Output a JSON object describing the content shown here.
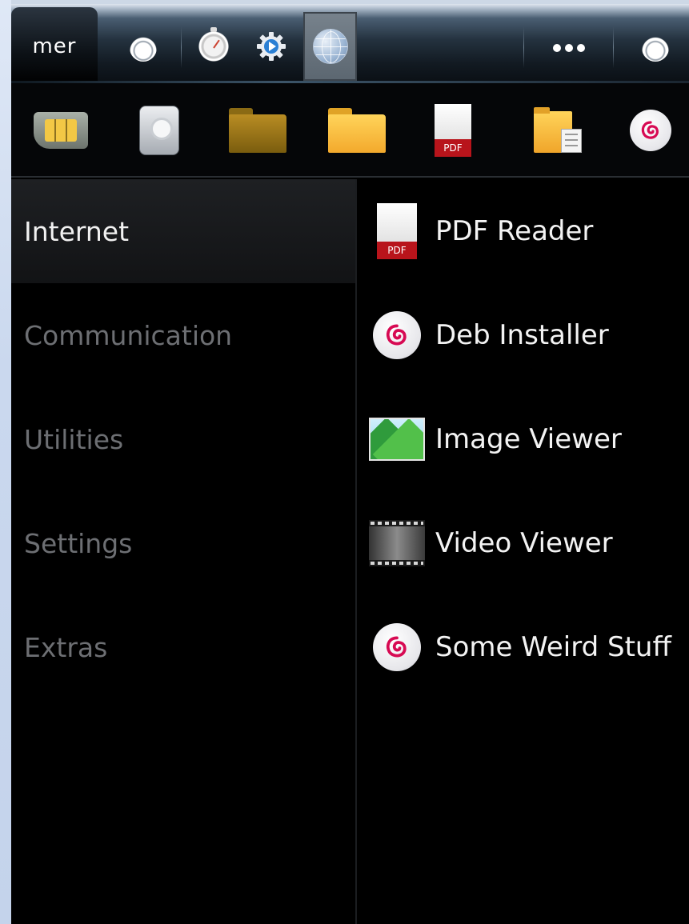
{
  "logo": {
    "text": "mer"
  },
  "shortcuts": {
    "pdf_label": "PDF"
  },
  "categories": [
    {
      "label": "Internet",
      "active": true
    },
    {
      "label": "Communication",
      "active": false
    },
    {
      "label": "Utilities",
      "active": false
    },
    {
      "label": "Settings",
      "active": false
    },
    {
      "label": "Extras",
      "active": false
    }
  ],
  "apps": [
    {
      "label": "PDF Reader",
      "icon": "pdf-icon",
      "icon_label": "PDF"
    },
    {
      "label": "Deb Installer",
      "icon": "debian-swirl-icon"
    },
    {
      "label": "Image Viewer",
      "icon": "image-viewer-icon"
    },
    {
      "label": "Video Viewer",
      "icon": "film-strip-icon"
    },
    {
      "label": "Some Weird Stuff",
      "icon": "debian-swirl-icon"
    }
  ],
  "colors": {
    "pdf_red": "#b8141b",
    "swirl_red": "#d70a53",
    "folder_yellow": "#ffd45a",
    "category_inactive": "#6d6f73"
  }
}
